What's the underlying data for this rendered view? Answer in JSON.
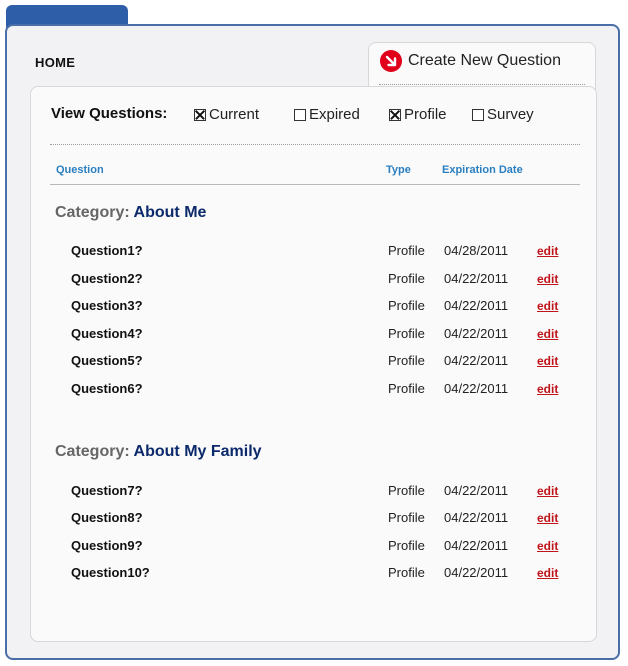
{
  "nav": {
    "home_label": "HOME"
  },
  "create": {
    "label": "Create New Question",
    "icon": "arrow-down-right-icon",
    "icon_color": "#e0001a"
  },
  "filters": {
    "label": "View Questions:",
    "options": [
      {
        "label": "Current",
        "checked": true
      },
      {
        "label": "Expired",
        "checked": false
      },
      {
        "label": "Profile",
        "checked": true
      },
      {
        "label": "Survey",
        "checked": false
      }
    ]
  },
  "columns": {
    "question": "Question",
    "type": "Type",
    "expiration": "Expiration Date"
  },
  "categories": [
    {
      "prefix": "Category:",
      "name": "About Me",
      "rows": [
        {
          "question": "Question1?",
          "type": "Profile",
          "date": "04/28/2011",
          "action": "edit"
        },
        {
          "question": "Question2?",
          "type": "Profile",
          "date": "04/22/2011",
          "action": "edit"
        },
        {
          "question": "Question3?",
          "type": "Profile",
          "date": "04/22/2011",
          "action": "edit"
        },
        {
          "question": "Question4?",
          "type": "Profile",
          "date": "04/22/2011",
          "action": "edit"
        },
        {
          "question": "Question5?",
          "type": "Profile",
          "date": "04/22/2011",
          "action": "edit"
        },
        {
          "question": "Question6?",
          "type": "Profile",
          "date": "04/22/2011",
          "action": "edit"
        }
      ]
    },
    {
      "prefix": "Category:",
      "name": "About My Family",
      "rows": [
        {
          "question": "Question7?",
          "type": "Profile",
          "date": "04/22/2011",
          "action": "edit"
        },
        {
          "question": "Question8?",
          "type": "Profile",
          "date": "04/22/2011",
          "action": "edit"
        },
        {
          "question": "Question9?",
          "type": "Profile",
          "date": "04/22/2011",
          "action": "edit"
        },
        {
          "question": "Question10?",
          "type": "Profile",
          "date": "04/22/2011",
          "action": "edit"
        }
      ]
    }
  ],
  "colors": {
    "accent_blue": "#2f5ea8",
    "header_blue": "#2a7fc1",
    "category_navy": "#0c2a6b",
    "edit_red": "#c0141b"
  }
}
